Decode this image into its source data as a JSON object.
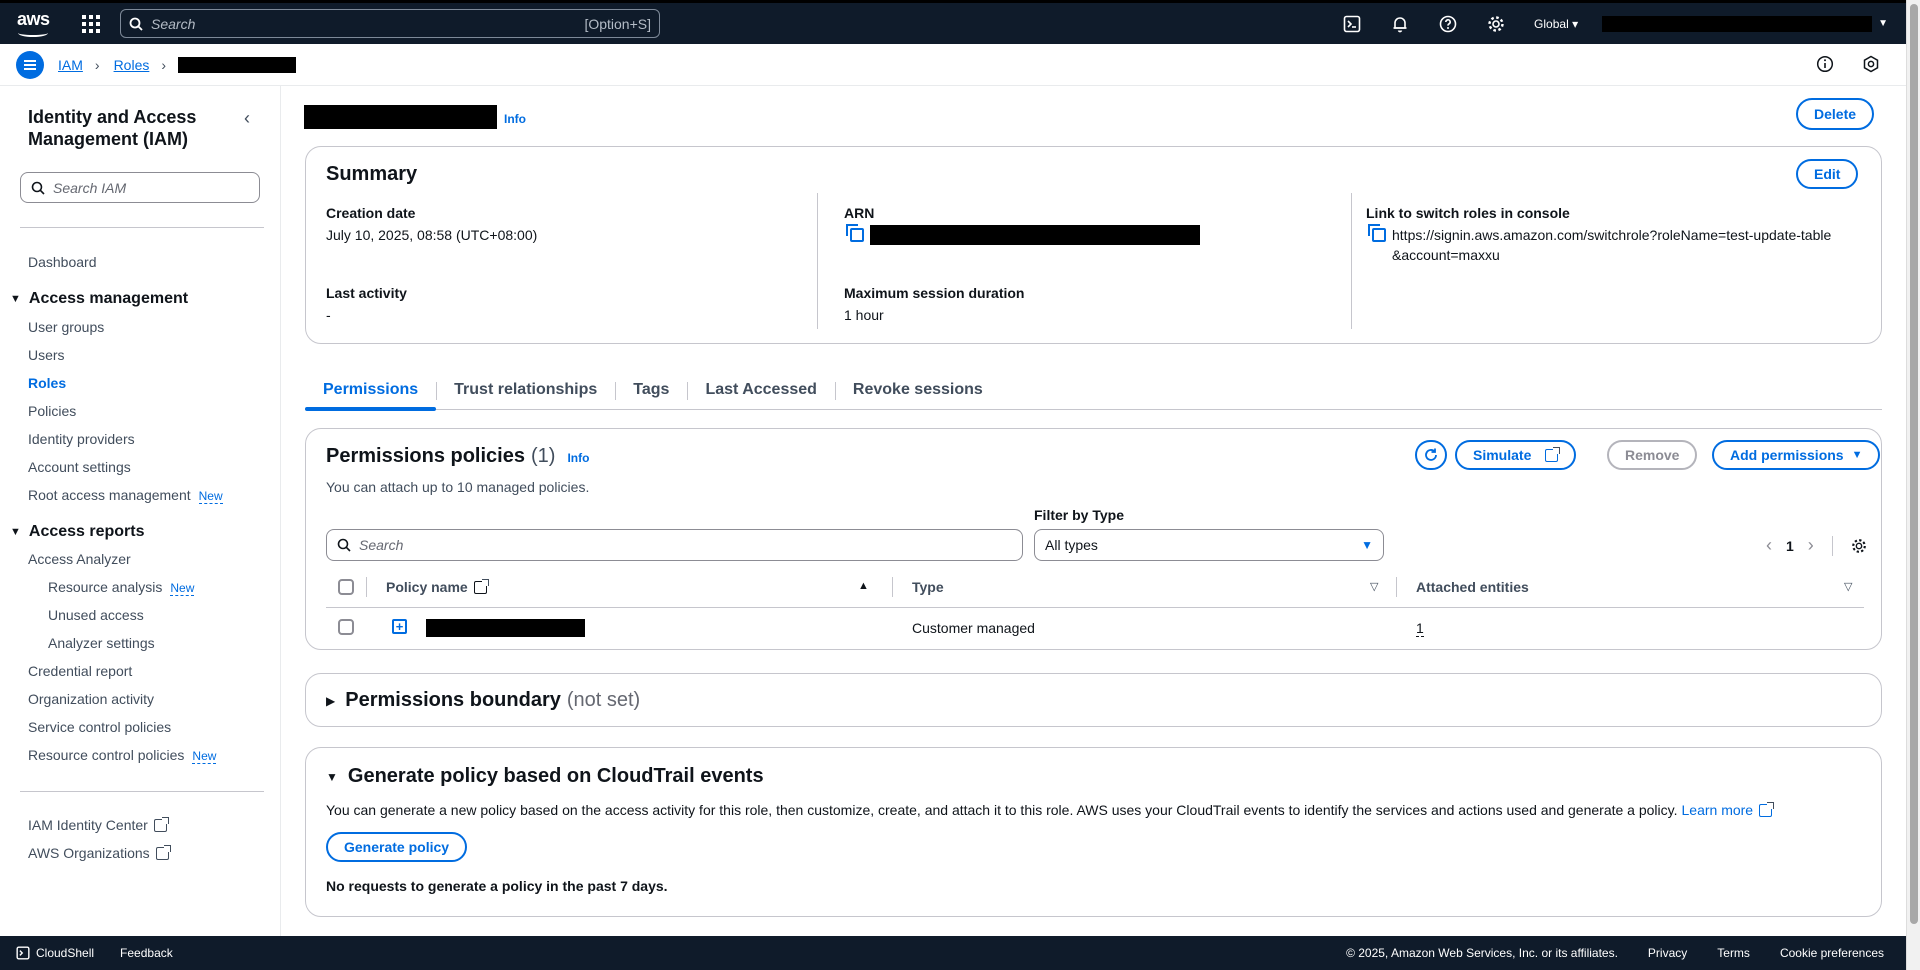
{
  "topbar": {
    "logo_text": "aws",
    "search_placeholder": "Search",
    "search_shortcut": "[Option+S]",
    "region": "Global"
  },
  "breadcrumb": {
    "items": [
      "IAM",
      "Roles"
    ]
  },
  "sidenav": {
    "title": "Identity and Access Management (IAM)",
    "search_placeholder": "Search IAM",
    "dashboard": "Dashboard",
    "access_management": {
      "label": "Access management",
      "items": [
        "User groups",
        "Users",
        "Roles",
        "Policies",
        "Identity providers",
        "Account settings",
        "Root access management"
      ]
    },
    "access_reports": {
      "label": "Access reports",
      "analyzer": "Access Analyzer",
      "sub_items": [
        "Resource analysis",
        "Unused access",
        "Analyzer settings"
      ],
      "items": [
        "Credential report",
        "Organization activity",
        "Service control policies",
        "Resource control policies"
      ]
    },
    "new_badge": "New",
    "external": [
      "IAM Identity Center",
      "AWS Organizations"
    ]
  },
  "page": {
    "info": "Info",
    "delete_label": "Delete"
  },
  "summary": {
    "title": "Summary",
    "edit_label": "Edit",
    "creation_date_label": "Creation date",
    "creation_date": "July 10, 2025, 08:58 (UTC+08:00)",
    "last_activity_label": "Last activity",
    "last_activity": "-",
    "arn_label": "ARN",
    "max_session_label": "Maximum session duration",
    "max_session": "1 hour",
    "switch_link_label": "Link to switch roles in console",
    "switch_link": "https://signin.aws.amazon.com/switchrole?roleName=test-update-table&account=maxxu"
  },
  "tabs": [
    "Permissions",
    "Trust relationships",
    "Tags",
    "Last Accessed",
    "Revoke sessions"
  ],
  "permissions": {
    "title": "Permissions policies",
    "count": "(1)",
    "info": "Info",
    "description": "You can attach up to 10 managed policies.",
    "simulate_label": "Simulate",
    "remove_label": "Remove",
    "add_label": "Add permissions",
    "filter_label": "Filter by Type",
    "search_placeholder": "Search",
    "filter_value": "All types",
    "page_number": "1",
    "columns": [
      "Policy name",
      "Type",
      "Attached entities"
    ],
    "rows": [
      {
        "type": "Customer managed",
        "attached": "1"
      }
    ]
  },
  "boundary": {
    "title": "Permissions boundary",
    "status": "(not set)"
  },
  "generate": {
    "title": "Generate policy based on CloudTrail events",
    "description": "You can generate a new policy based on the access activity for this role, then customize, create, and attach it to this role. AWS uses your CloudTrail events to identify the services and actions used and generate a policy.",
    "learn_more": "Learn more",
    "button_label": "Generate policy",
    "note": "No requests to generate a policy in the past 7 days."
  },
  "footer": {
    "cloudshell": "CloudShell",
    "feedback": "Feedback",
    "copyright": "© 2025, Amazon Web Services, Inc. or its affiliates.",
    "links": [
      "Privacy",
      "Terms",
      "Cookie preferences"
    ]
  }
}
